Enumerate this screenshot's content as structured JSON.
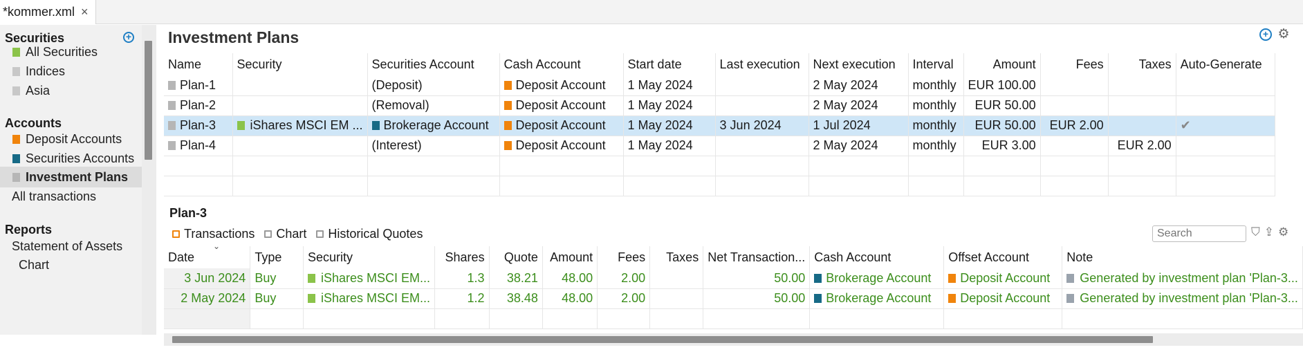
{
  "tab": {
    "title": "*kommer.xml",
    "close": "×"
  },
  "sidebar": {
    "securities_header": "Securities",
    "securities_items": [
      {
        "label": "All Securities",
        "icon": "green-doc-icon"
      },
      {
        "label": "Indices",
        "icon": "grey-doc-icon"
      },
      {
        "label": "Asia",
        "icon": "grey-doc-icon"
      }
    ],
    "accounts_header": "Accounts",
    "accounts_items": [
      {
        "label": "Deposit Accounts",
        "icon": "orange-square-icon"
      },
      {
        "label": "Securities Accounts",
        "icon": "teal-square-icon"
      },
      {
        "label": "Investment Plans",
        "icon": "grey-square-icon"
      },
      {
        "label": "All transactions"
      }
    ],
    "reports_header": "Reports",
    "reports_items": [
      {
        "label": "Statement of Assets"
      },
      {
        "label": "Chart"
      }
    ]
  },
  "main": {
    "title": "Investment Plans",
    "plans_columns": [
      "Name",
      "Security",
      "Securities Account",
      "Cash Account",
      "Start date",
      "Last execution",
      "Next execution",
      "Interval",
      "Amount",
      "Fees",
      "Taxes",
      "Auto-Generate"
    ],
    "plans": [
      {
        "name": "Plan-1",
        "security": "",
        "securities_account": "(Deposit)",
        "cash_account": "Deposit Account",
        "start": "1 May 2024",
        "last": "",
        "next": "2 May 2024",
        "interval": "monthly",
        "amount": "EUR 100.00",
        "fees": "",
        "taxes": "",
        "auto": ""
      },
      {
        "name": "Plan-2",
        "security": "",
        "securities_account": "(Removal)",
        "cash_account": "Deposit Account",
        "start": "1 May 2024",
        "last": "",
        "next": "2 May 2024",
        "interval": "monthly",
        "amount": "EUR 50.00",
        "fees": "",
        "taxes": "",
        "auto": ""
      },
      {
        "name": "Plan-3",
        "security": "iShares MSCI EM ...",
        "securities_account": "Brokerage Account",
        "cash_account": "Deposit Account",
        "start": "1 May 2024",
        "last": "3 Jun 2024",
        "next": "1 Jul 2024",
        "interval": "monthly",
        "amount": "EUR 50.00",
        "fees": "EUR 2.00",
        "taxes": "",
        "auto": "✔"
      },
      {
        "name": "Plan-4",
        "security": "",
        "securities_account": "(Interest)",
        "cash_account": "Deposit Account",
        "start": "1 May 2024",
        "last": "",
        "next": "2 May 2024",
        "interval": "monthly",
        "amount": "EUR 3.00",
        "fees": "",
        "taxes": "EUR 2.00",
        "auto": ""
      }
    ],
    "detail": {
      "title": "Plan-3",
      "tabs": [
        "Transactions",
        "Chart",
        "Historical Quotes"
      ],
      "search_placeholder": "Search",
      "columns": [
        "Date",
        "Type",
        "Security",
        "Shares",
        "Quote",
        "Amount",
        "Fees",
        "Taxes",
        "Net Transaction...",
        "Cash Account",
        "Offset Account",
        "Note"
      ],
      "rows": [
        {
          "date": "3 Jun 2024",
          "type": "Buy",
          "security": "iShares MSCI EM...",
          "shares": "1.3",
          "quote": "38.21",
          "amount": "48.00",
          "fees": "2.00",
          "taxes": "",
          "net": "50.00",
          "cash": "Brokerage Account",
          "offset": "Deposit Account",
          "note": "Generated by investment plan 'Plan-3..."
        },
        {
          "date": "2 May 2024",
          "type": "Buy",
          "security": "iShares MSCI EM...",
          "shares": "1.2",
          "quote": "38.48",
          "amount": "48.00",
          "fees": "2.00",
          "taxes": "",
          "net": "50.00",
          "cash": "Brokerage Account",
          "offset": "Deposit Account",
          "note": "Generated by investment plan 'Plan-3..."
        }
      ]
    }
  },
  "colors": {
    "selection": "#cfe6f7",
    "accent": "#1f7fc4",
    "positive": "#3c8e1c",
    "deposit": "#f0840c",
    "brokerage": "#176a86"
  }
}
